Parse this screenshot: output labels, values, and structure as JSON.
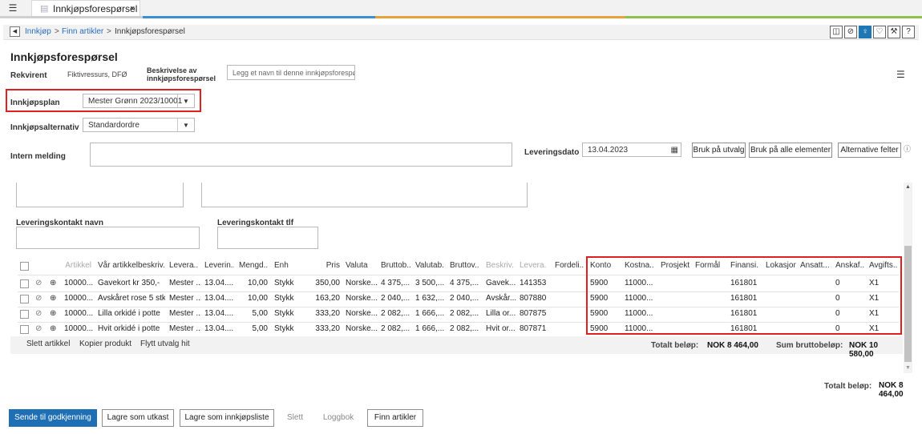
{
  "tabbar": {
    "tab_label": "Innkjøpsforespørsel",
    "close": "×",
    "menu_icon": "list-menu-icon",
    "tab_icon": "document-icon"
  },
  "breadcrumb": {
    "items": [
      "Innkjøp",
      "Finn artikler",
      "Innkjøpsforespørsel"
    ],
    "separator": ">"
  },
  "toolbar_icons": [
    "panel-icon",
    "paperclip-icon",
    "lightbulb-icon",
    "heart-icon",
    "wrench-icon",
    "help-icon"
  ],
  "toolbar_glyphs": [
    "◫",
    "⊘",
    "♀",
    "♡",
    "⚒",
    "?"
  ],
  "page": {
    "title": "Innkjøpsforespørsel"
  },
  "form": {
    "rekvirent_label": "Rekvirent",
    "rekvirent_value": "Fiktivressurs, DFØ",
    "beskrivelse_label": "Beskrivelse av innkjøpsforespørsel",
    "beskrivelse_placeholder": "Legg et navn til denne innkjøpsforespø...",
    "innkjopsplan_label": "Innkjøpsplan",
    "innkjopsplan_value": "Mester Grønn 2023/10001",
    "innkjopsalternativ_label": "Innkjøpsalternativ",
    "innkjopsalternativ_value": "Standardordre",
    "intern_melding_label": "Intern melding",
    "leveringsdato_label": "Leveringsdato",
    "leveringsdato_value": "13.04.2023",
    "bruk_pa_utvalg": "Bruk på utvalg",
    "bruk_pa_alle": "Bruk på alle elementer",
    "alternative_felter": "Alternative felter",
    "leveringskontakt_navn_label": "Leveringskontakt navn",
    "leveringskontakt_tlf_label": "Leveringskontakt tlf"
  },
  "grid": {
    "headers": [
      "Artikkel",
      "Vår artikkelbeskriv...",
      "Levera...",
      "Leverin...",
      "Mengd...",
      "Enh",
      "Pris",
      "Valuta",
      "Bruttob...",
      "Valutab...",
      "Bruttov...",
      "Beskriv...",
      "Levera...",
      "Fordeli...",
      "Konto",
      "Kostna...",
      "Prosjekt",
      "Formål",
      "Finansi...",
      "Lokasjon",
      "Ansatt...",
      "Anskaf...",
      "Avgifts..."
    ],
    "rows": [
      [
        "10000...",
        "Gavekort kr 350,-",
        "Mester ...",
        "13.04....",
        "10,00",
        "Stykk",
        "350,00",
        "Norske...",
        "4 375,...",
        "3 500,...",
        "4 375,...",
        "Gavek...",
        "141353",
        "",
        "5900",
        "11000...",
        "",
        "",
        "161801",
        "",
        "",
        "0",
        "X1"
      ],
      [
        "10000...",
        "Avskåret rose 5 stk",
        "Mester ...",
        "13.04....",
        "10,00",
        "Stykk",
        "163,20",
        "Norske...",
        "2 040,...",
        "1 632,...",
        "2 040,...",
        "Avskår...",
        "807880",
        "",
        "5900",
        "11000...",
        "",
        "",
        "161801",
        "",
        "",
        "0",
        "X1"
      ],
      [
        "10000...",
        "Lilla orkidé i potte",
        "Mester ...",
        "13.04....",
        "5,00",
        "Stykk",
        "333,20",
        "Norske...",
        "2 082,...",
        "1 666,...",
        "2 082,...",
        "Lilla or...",
        "807875",
        "",
        "5900",
        "11000...",
        "",
        "",
        "161801",
        "",
        "",
        "0",
        "X1"
      ],
      [
        "10000...",
        "Hvit orkidé i potte",
        "Mester ...",
        "13.04....",
        "5,00",
        "Stykk",
        "333,20",
        "Norske...",
        "2 082,...",
        "1 666,...",
        "2 082,...",
        "Hvit or...",
        "807871",
        "",
        "5900",
        "11000...",
        "",
        "",
        "161801",
        "",
        "",
        "0",
        "X1"
      ]
    ],
    "row_icons": [
      "paperclip-icon",
      "zoom-in-icon"
    ]
  },
  "grid_footer": {
    "slett_artikkel": "Slett artikkel",
    "kopier_produkt": "Kopier produkt",
    "flytt_utvalg": "Flytt utvalg hit",
    "totalt_belop_label": "Totalt beløp:",
    "totalt_belop_value": "NOK 8 464,00",
    "sum_brutto_label": "Sum bruttobeløp:",
    "sum_brutto_value": "NOK 10 580,00"
  },
  "summary": {
    "totalt_label": "Totalt beløp:",
    "totalt_value": "NOK 8 464,00"
  },
  "actions": {
    "send": "Sende til godkjenning",
    "lagre_utkast": "Lagre som utkast",
    "lagre_innkjopsliste": "Lagre som innkjøpsliste",
    "slett": "Slett",
    "loggbok": "Loggbok",
    "finn_artikler": "Finn artikler"
  },
  "colors": {
    "primary": "#1f6fb5",
    "highlight": "#e02020",
    "link": "#2a6ebb"
  }
}
